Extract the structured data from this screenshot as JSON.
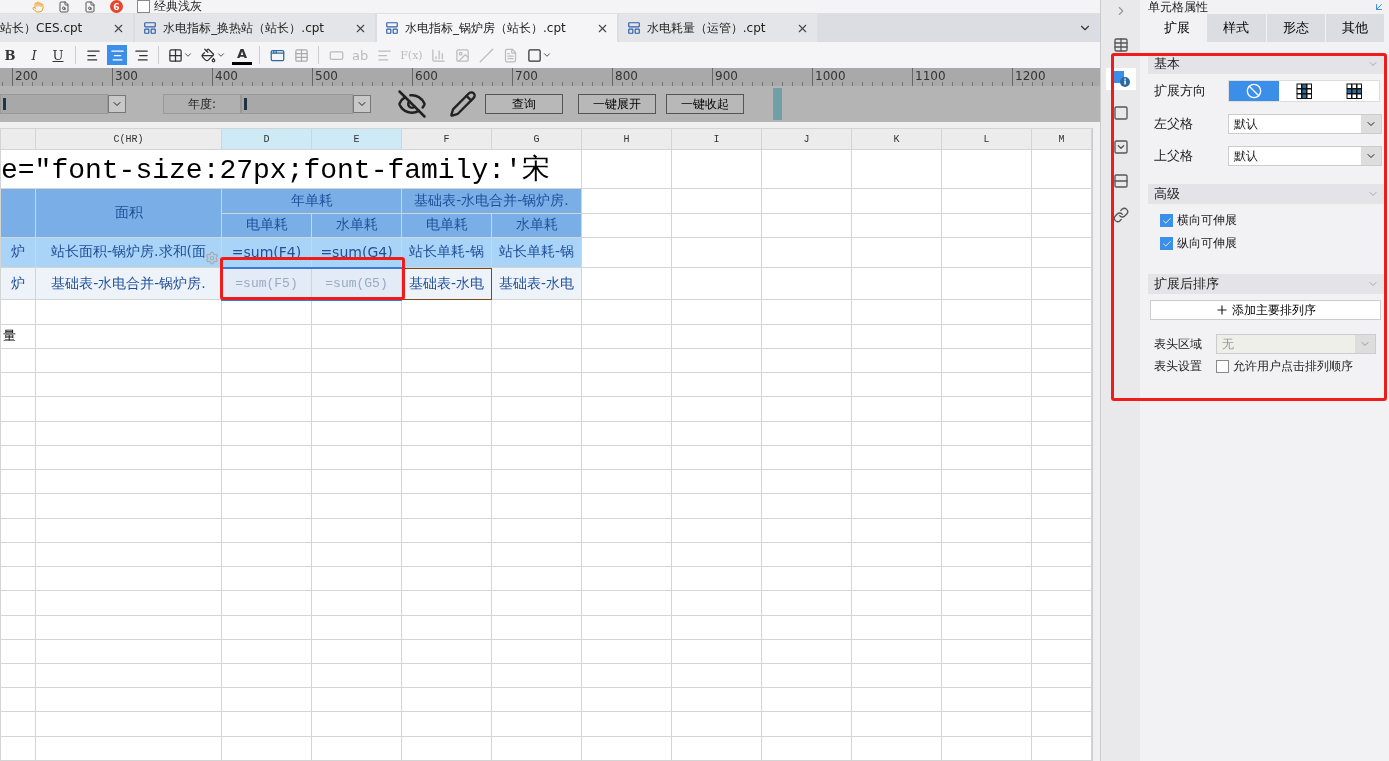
{
  "top_toolbar": {
    "badge": "6",
    "theme_checkbox": {
      "label": "经典浅灰",
      "checked": false
    }
  },
  "tabs": [
    {
      "label": "站长）CES.cpt",
      "selected": false,
      "cut": true
    },
    {
      "label": "水电指标_换热站（站长）.cpt",
      "selected": false,
      "cut": false
    },
    {
      "label": "水电指标_锅炉房（站长）.cpt",
      "selected": true,
      "cut": false
    },
    {
      "label": "水电耗量（运管）.cpt",
      "selected": false,
      "cut": false
    }
  ],
  "format_toolbar": {
    "text_styles": [
      "B",
      "I",
      "U"
    ],
    "align_buttons": [
      {
        "selected": false
      },
      {
        "selected": true
      },
      {
        "selected": false
      }
    ],
    "font_color_letter": "A",
    "text_tool": "ab",
    "formula_tool": "F(x)"
  },
  "ruler": {
    "labels": [
      "200",
      "300",
      "400",
      "500",
      "600",
      "700",
      "800",
      "900",
      "1000",
      "1100",
      "1200"
    ]
  },
  "parameters": {
    "year_label": "年度:",
    "buttons": [
      "查询",
      "一键展开",
      "一键收起"
    ]
  },
  "sheet": {
    "columns": [
      {
        "selected": false
      },
      {
        "label": "C(HR)",
        "selected": false
      },
      {
        "label": "D",
        "selected": true
      },
      {
        "label": "E",
        "selected": true
      },
      {
        "label": "F",
        "selected": false
      },
      {
        "label": "G",
        "selected": false
      },
      {
        "label": "H",
        "selected": false
      },
      {
        "label": "I",
        "selected": false
      },
      {
        "label": "J",
        "selected": false
      },
      {
        "label": "K",
        "selected": false
      },
      {
        "label": "L",
        "selected": false
      },
      {
        "label": "M",
        "selected": false
      }
    ],
    "rows": [
      {
        "cells": [
          {
            "text": "e=\"font-size:27px;font-family:'宋",
            "kind": "title",
            "colspan": 6
          }
        ]
      },
      {
        "cells": [
          {
            "text": "",
            "kind": "header",
            "rowspan": 2
          },
          {
            "text": "面积",
            "kind": "header",
            "rowspan": 2
          },
          {
            "text": "年单耗",
            "kind": "header",
            "colspan": 2
          },
          {
            "text": "基础表-水电合并-锅炉房.",
            "kind": "header",
            "colspan": 2
          }
        ]
      },
      {
        "cells": [
          {
            "text": "电单耗",
            "kind": "header"
          },
          {
            "text": "水单耗",
            "kind": "header"
          },
          {
            "text": "电单耗",
            "kind": "header"
          },
          {
            "text": "水单耗",
            "kind": "header"
          }
        ]
      },
      {
        "cells": [
          {
            "text": "炉",
            "kind": "data"
          },
          {
            "text": "站长面积-锅炉房.求和(面",
            "kind": "data"
          },
          {
            "text": "=sum(F4)",
            "kind": "data"
          },
          {
            "text": "=sum(G4)",
            "kind": "data"
          },
          {
            "text": "站长单耗-锅",
            "kind": "data"
          },
          {
            "text": "站长单耗-锅",
            "kind": "data"
          }
        ]
      },
      {
        "cells": [
          {
            "text": "炉",
            "kind": "body"
          },
          {
            "text": "基础表-水电合并-锅炉房.",
            "kind": "body"
          },
          {
            "text": "=sum(F5)",
            "kind": "selected"
          },
          {
            "text": "=sum(G5)",
            "kind": "selected"
          },
          {
            "text": "基础表-水电",
            "kind": "current"
          },
          {
            "text": "基础表-水电",
            "kind": "body"
          }
        ]
      },
      {
        "cells": []
      },
      {
        "cells": [
          {
            "text": "量",
            "kind": "plain"
          }
        ]
      }
    ]
  },
  "cell_panel": {
    "title": "单元格属性",
    "tabs": [
      {
        "label": "扩展",
        "selected": true
      },
      {
        "label": "样式",
        "selected": false
      },
      {
        "label": "形态",
        "selected": false
      },
      {
        "label": "其他",
        "selected": false
      }
    ],
    "basic": {
      "title": "基本",
      "direction": {
        "label": "扩展方向",
        "options": [
          {
            "selected": true
          },
          {
            "selected": false
          },
          {
            "selected": false
          }
        ]
      },
      "selects": [
        {
          "label": "左父格",
          "value": "默认",
          "disabled": false
        },
        {
          "label": "上父格",
          "value": "默认",
          "disabled": false
        }
      ]
    },
    "advanced": {
      "title": "高级",
      "checkboxes": [
        {
          "label": "横向可伸展",
          "checked": true
        },
        {
          "label": "纵向可伸展",
          "checked": true
        }
      ]
    },
    "sort": {
      "title": "扩展后排序",
      "add_button": "添加主要排列序",
      "header_area": {
        "label": "表头区域",
        "value": "无",
        "disabled": true
      },
      "header_setting": {
        "label": "表头设置",
        "checkbox": {
          "label": "允许用户点击排列顺序",
          "checked": false
        }
      }
    }
  }
}
